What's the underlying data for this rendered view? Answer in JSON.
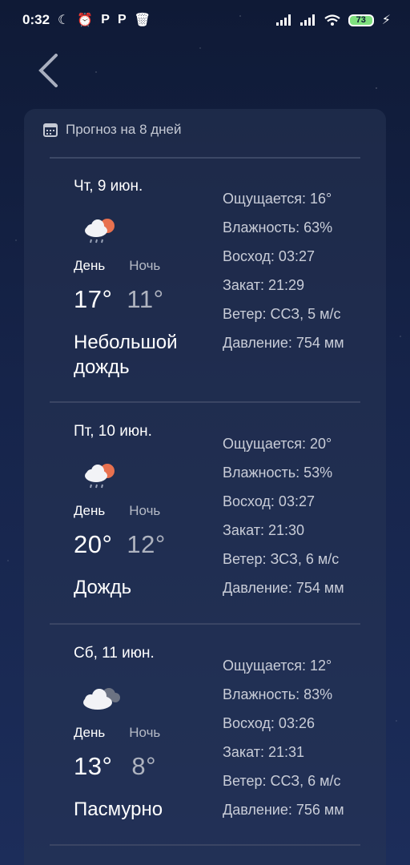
{
  "status": {
    "time": "0:32",
    "battery": "73"
  },
  "card": {
    "title": "Прогноз на 8 дней"
  },
  "days": [
    {
      "date": "Чт, 9 июн.",
      "day_label": "День",
      "night_label": "Ночь",
      "day_temp": "17°",
      "night_temp": "11°",
      "condition": "Небольшой дождь",
      "icon": "cloud-sun-rain-icon",
      "feels": "Ощущается: 16°",
      "humidity": "Влажность: 63%",
      "sunrise": "Восход: 03:27",
      "sunset": "Закат: 21:29",
      "wind": "Ветер: ССЗ, 5 м/с",
      "pressure": "Давление: 754 мм"
    },
    {
      "date": "Пт, 10 июн.",
      "day_label": "День",
      "night_label": "Ночь",
      "day_temp": "20°",
      "night_temp": "12°",
      "condition": "Дождь",
      "icon": "cloud-sun-rain-icon",
      "feels": "Ощущается: 20°",
      "humidity": "Влажность: 53%",
      "sunrise": "Восход: 03:27",
      "sunset": "Закат: 21:30",
      "wind": "Ветер: ЗСЗ, 6 м/с",
      "pressure": "Давление: 754 мм"
    },
    {
      "date": "Сб, 11 июн.",
      "day_label": "День",
      "night_label": "Ночь",
      "day_temp": "13°",
      "night_temp": "8°",
      "condition": "Пасмурно",
      "icon": "overcast-clouds-icon",
      "feels": "Ощущается: 12°",
      "humidity": "Влажность: 83%",
      "sunrise": "Восход: 03:26",
      "sunset": "Закат: 21:31",
      "wind": "Ветер: ССЗ, 6 м/с",
      "pressure": "Давление: 756 мм"
    }
  ]
}
